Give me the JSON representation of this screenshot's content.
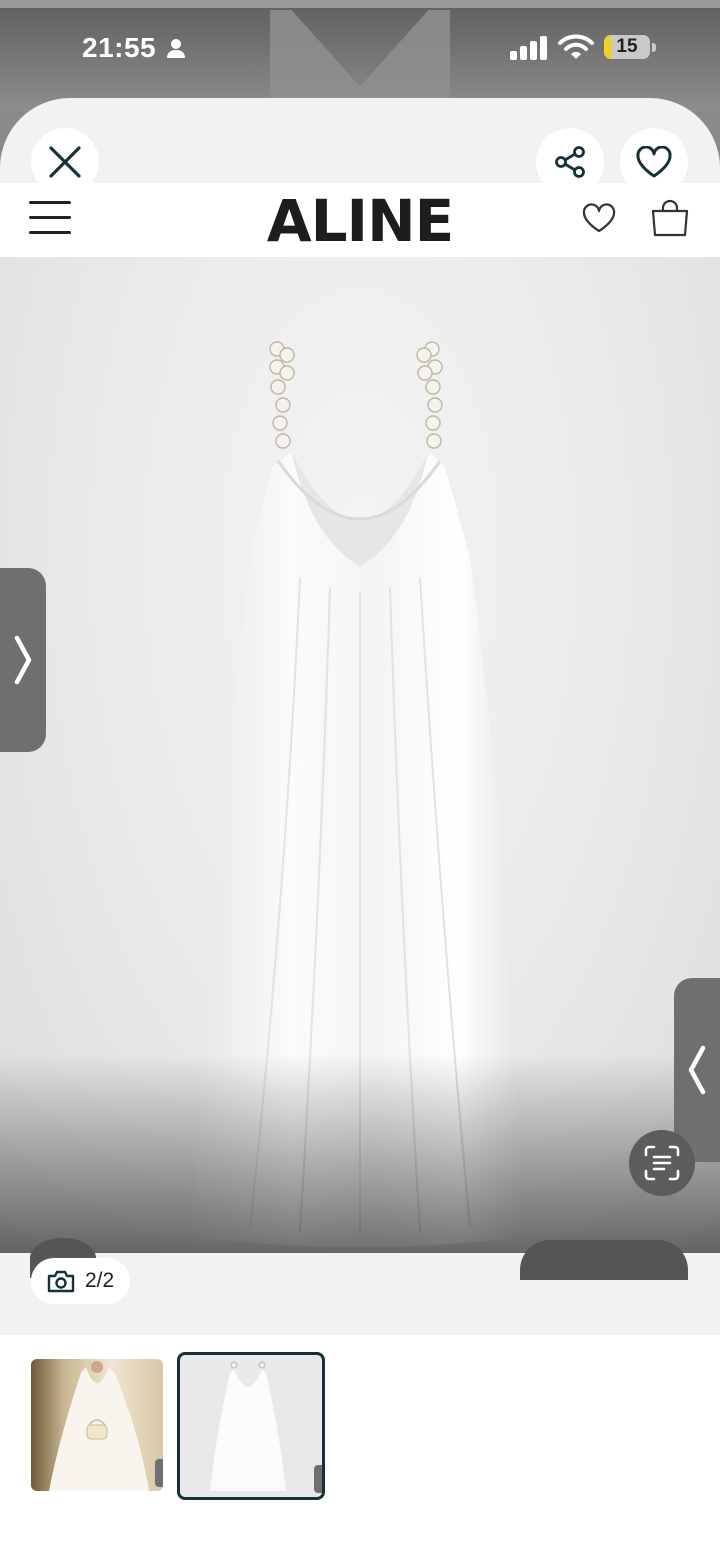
{
  "status_bar": {
    "time": "21:55",
    "battery_level": "15",
    "battery_fraction": 0.15,
    "icons": [
      "person-icon",
      "cellular-signal-icon",
      "wifi-icon",
      "battery-icon"
    ]
  },
  "overlay_controls": {
    "close_icon": "close-icon",
    "share_icon": "share-icon",
    "favorite_icon": "heart-outline-icon"
  },
  "site_header": {
    "logo": "ALINE",
    "menu_icon": "hamburger-menu-icon",
    "wishlist_icon": "heart-outline-icon",
    "bag_icon": "shopping-bag-icon"
  },
  "gallery": {
    "prev_icon": "chevron-right-icon",
    "next_icon": "chevron-left-icon",
    "scan_icon": "visual-search-icon",
    "photo_counter": "2/2",
    "camera_icon": "camera-icon",
    "selected_index": 2
  },
  "colors": {
    "sheet_background": "#f1f2f4",
    "selected_thumb_border": "#163238",
    "side_tab": "#6f6f6f",
    "battery_fill": "#f2d21a"
  }
}
